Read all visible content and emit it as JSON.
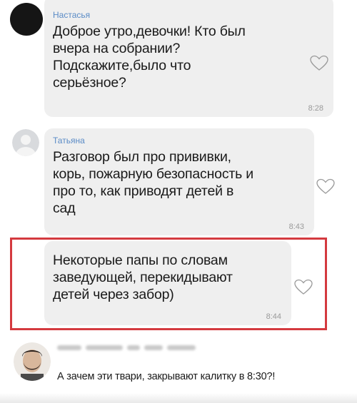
{
  "messages": [
    {
      "sender": "Настасья",
      "text_lines": [
        "Доброе утро,девочки! Кто был",
        "вчера на собрании?",
        "Подскажите,было что",
        "серьёзное?"
      ],
      "time": "8:28"
    },
    {
      "sender": "Татьяна",
      "text_lines": [
        "Разговор был про прививки,",
        "корь, пожарную безопасность и",
        "про то, как приводят детей в",
        "сад"
      ],
      "time": "8:43"
    },
    {
      "sender": "",
      "text_lines": [
        "Некоторые папы по словам",
        "заведующей, перекидывают",
        "детей через забор)"
      ],
      "time": "8:44"
    }
  ],
  "last_message": {
    "text": "А зачем эти твари, закрывают калитку в 8:30?!"
  },
  "icons": {
    "like": "heart-outline-icon",
    "avatar_placeholder": "default-avatar-icon"
  },
  "colors": {
    "sender_name": "#5a8bc6",
    "bubble_bg": "#efefef",
    "highlight_border": "#d43a3f",
    "time_text": "#9a9a9a"
  }
}
